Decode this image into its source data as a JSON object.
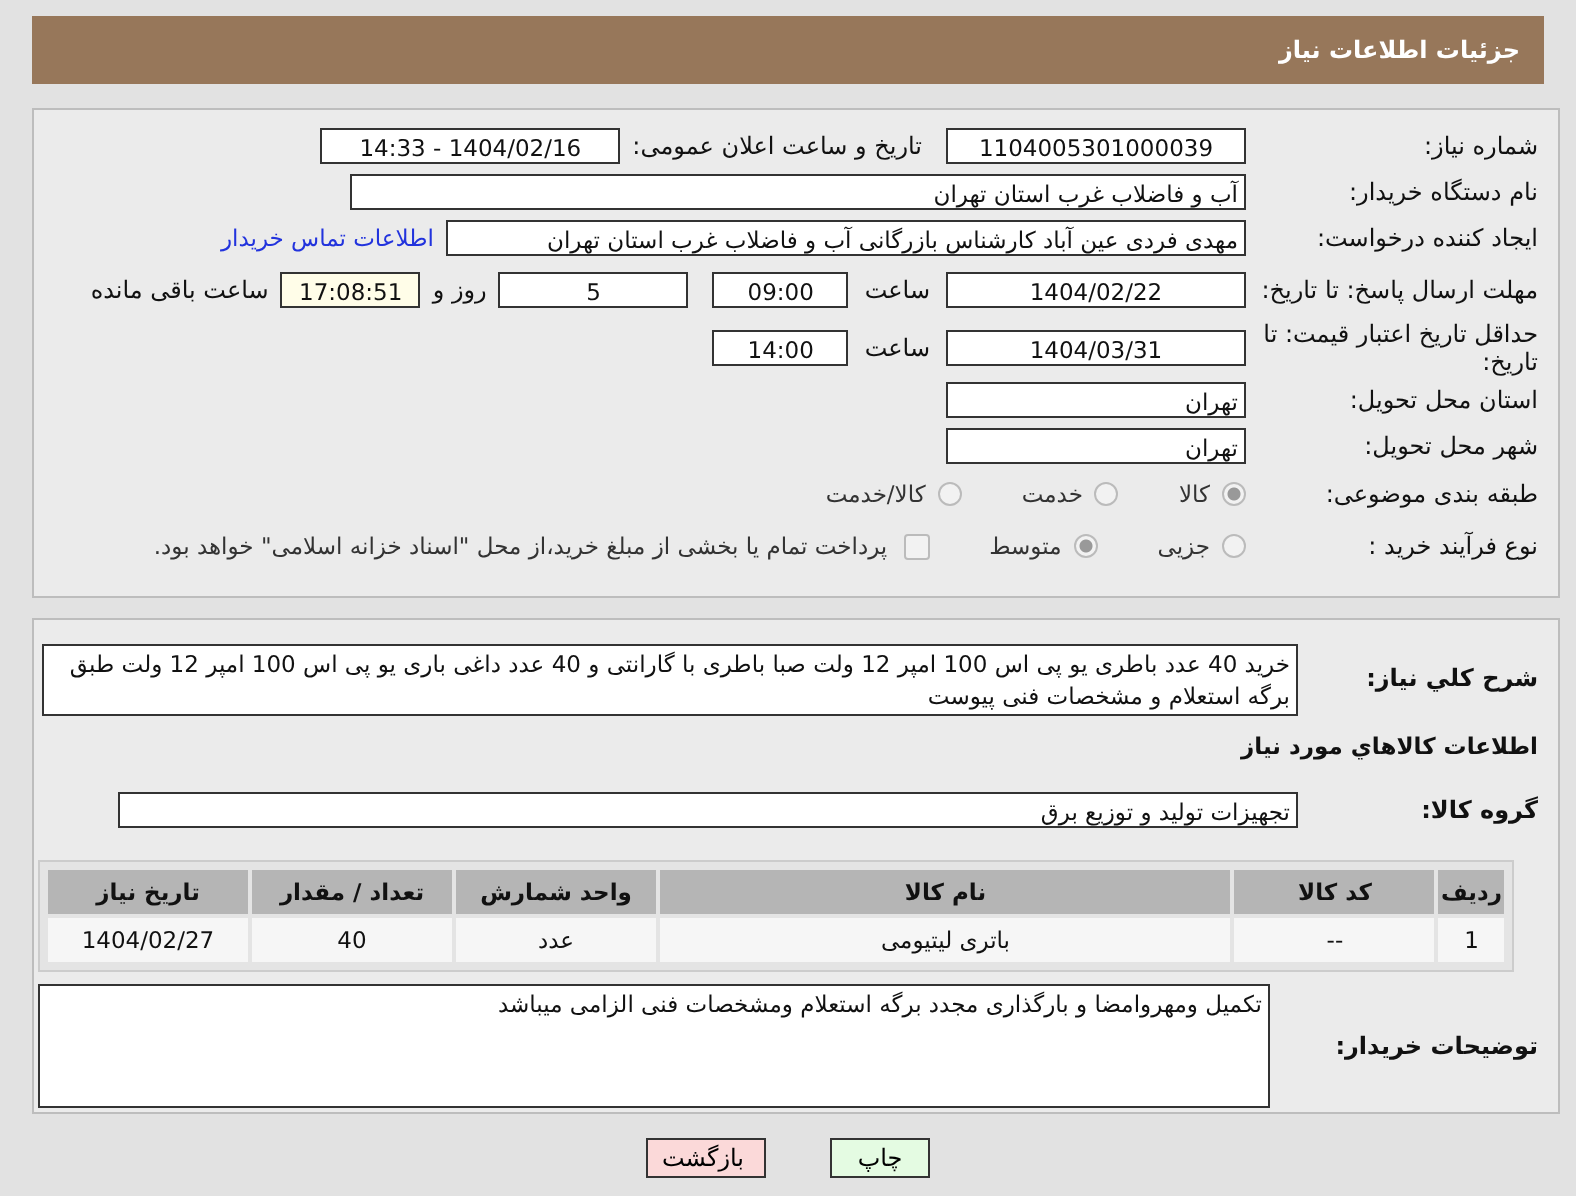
{
  "header": {
    "title": "جزئیات اطلاعات نیاز"
  },
  "need_number": {
    "label": "شماره نیاز:",
    "value": "1104005301000039"
  },
  "announce": {
    "label": "تاریخ و ساعت اعلان عمومی:",
    "value": "1404/02/16 - 14:33"
  },
  "buyer_org": {
    "label": "نام دستگاه خریدار:",
    "value": "آب و فاضلاب غرب استان تهران"
  },
  "requester": {
    "label": "ایجاد کننده درخواست:",
    "value": "مهدی فردی عین آباد کارشناس بازرگانی آب و فاضلاب غرب استان تهران",
    "link": "اطلاعات تماس خریدار"
  },
  "deadline": {
    "label": "مهلت ارسال پاسخ: تا تاریخ:",
    "date": "1404/02/22",
    "time_label": "ساعت",
    "time": "09:00",
    "days": "5",
    "days_label": "روز و",
    "remaining": "17:08:51",
    "remaining_label": "ساعت باقی مانده"
  },
  "validity": {
    "label": "حداقل تاریخ اعتبار قیمت: تا تاریخ:",
    "date": "1404/03/31",
    "time_label": "ساعت",
    "time": "14:00"
  },
  "province": {
    "label": "استان محل تحویل:",
    "value": "تهران"
  },
  "city": {
    "label": "شهر محل تحویل:",
    "value": "تهران"
  },
  "category": {
    "label": "طبقه بندی موضوعی:",
    "options": [
      {
        "label": "کالا",
        "selected": true
      },
      {
        "label": "خدمت",
        "selected": false
      },
      {
        "label": "کالا/خدمت",
        "selected": false
      }
    ]
  },
  "process": {
    "label": "نوع فرآیند خرید :",
    "options": [
      {
        "label": "جزیی",
        "selected": false
      },
      {
        "label": "متوسط",
        "selected": true
      }
    ],
    "payment": {
      "label": "پرداخت تمام یا بخشی از مبلغ خرید،از محل \"اسناد خزانه اسلامی\" خواهد بود.",
      "checked": false
    }
  },
  "description": {
    "label": "شرح کلي نياز:",
    "value": "خرید 40 عدد باطری یو پی اس 100 امپر 12 ولت صبا باطری با گارانتی و 40 عدد داغی باری یو پی اس 100 امپر 12 ولت طبق برگه استعلام و مشخصات فنی پیوست"
  },
  "goods_heading": "اطلاعات كالاهاي مورد نياز",
  "goods_group": {
    "label": "گروه کالا:",
    "value": "تجهیزات تولید و توزیع برق"
  },
  "table": {
    "columns": [
      "ردیف",
      "کد کالا",
      "نام کالا",
      "واحد شمارش",
      "تعداد / مقدار",
      "تاریخ نیاز"
    ],
    "rows": [
      [
        "1",
        "--",
        "باتری لیتیومی",
        "عدد",
        "40",
        "1404/02/27"
      ]
    ]
  },
  "buyer_notes": {
    "label": "توضیحات خریدار:",
    "value": "تکمیل ومهروامضا و بارگذاری مجدد برگه استعلام ومشخصات فنی الزامی میباشد"
  },
  "buttons": [
    {
      "label": "چاپ",
      "kind": "print"
    },
    {
      "label": "بازگشت",
      "kind": "back"
    }
  ]
}
